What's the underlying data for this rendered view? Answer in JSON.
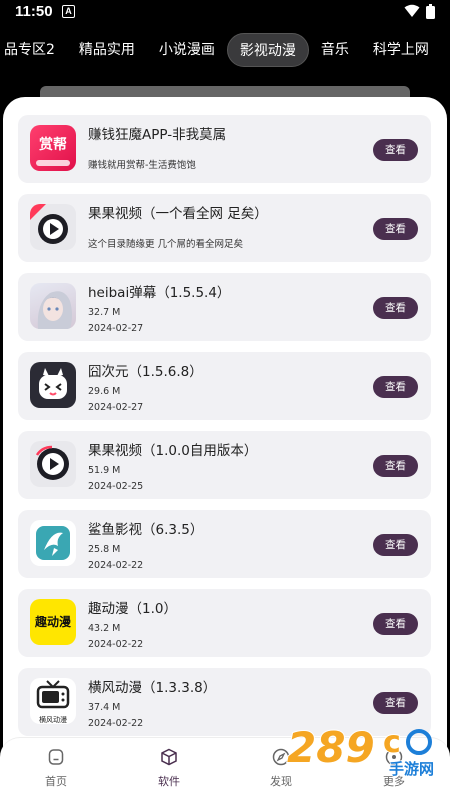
{
  "status_bar": {
    "time": "11:50",
    "notification_badge": "A"
  },
  "tabs": [
    {
      "label": "品专区2",
      "active": false
    },
    {
      "label": "精品实用",
      "active": false
    },
    {
      "label": "小说漫画",
      "active": false
    },
    {
      "label": "影视动漫",
      "active": true
    },
    {
      "label": "音乐",
      "active": false
    },
    {
      "label": "科学上网",
      "active": false
    }
  ],
  "apps": [
    {
      "name": "赚钱狂魔APP-非我莫属",
      "desc": "赚钱就用赏帮-生活费饱饱",
      "icon": "reward-app-icon",
      "icon_text": "赏帮",
      "button": "查看"
    },
    {
      "name": "果果视频（一个看全网 足矣）",
      "desc": "这个目录随缘更 几个屌的看全网足矣",
      "icon": "play-icon",
      "button": "查看"
    },
    {
      "name": "heibai弹幕（1.5.5.4）",
      "size": "32.7 M",
      "date": "2024-02-27",
      "icon": "anime-avatar-icon",
      "button": "查看"
    },
    {
      "name": "囧次元（1.5.6.8）",
      "size": "29.6 M",
      "date": "2024-02-27",
      "icon": "mascot-icon",
      "button": "查看"
    },
    {
      "name": "果果视频（1.0.0自用版本）",
      "size": "51.9 M",
      "date": "2024-02-25",
      "icon": "play-icon",
      "button": "查看"
    },
    {
      "name": "鲨鱼影视（6.3.5）",
      "size": "25.8 M",
      "date": "2024-02-22",
      "icon": "shark-icon",
      "button": "查看"
    },
    {
      "name": "趣动漫（1.0）",
      "size": "43.2 M",
      "date": "2024-02-22",
      "icon": "qu-dongman-icon",
      "icon_text": "趣动漫",
      "button": "查看"
    },
    {
      "name": "横风动漫（1.3.3.8）",
      "size": "37.4 M",
      "date": "2024-02-22",
      "icon": "tv-icon",
      "icon_text": "横风动漫",
      "button": "查看"
    }
  ],
  "bottom_nav": [
    {
      "label": "首页",
      "icon": "home-icon",
      "active": false
    },
    {
      "label": "软件",
      "icon": "cube-icon",
      "active": true
    },
    {
      "label": "发现",
      "icon": "compass-icon",
      "active": false
    },
    {
      "label": "更多",
      "icon": "more-icon",
      "active": false
    }
  ],
  "watermark": {
    "text": "289",
    "suffix": "c",
    "sub": "手游网"
  },
  "colors": {
    "accent": "#4a2f4f",
    "card_bg": "#f1f1f4",
    "background": "#000000"
  }
}
